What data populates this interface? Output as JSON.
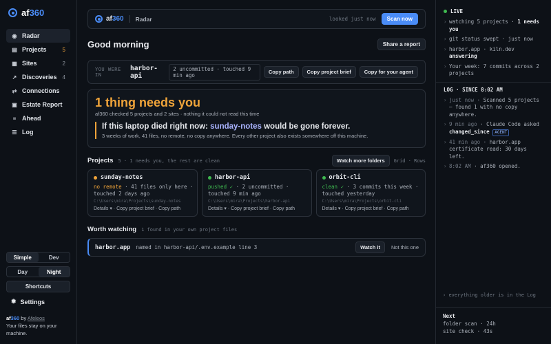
{
  "brand": {
    "name_prefix": "af",
    "name_num": "360"
  },
  "sidebar": {
    "items": [
      {
        "label": "Radar",
        "icon": "radar-icon",
        "count": ""
      },
      {
        "label": "Projects",
        "icon": "bar-chart-icon",
        "count": "5"
      },
      {
        "label": "Sites",
        "icon": "server-icon",
        "count": "2"
      },
      {
        "label": "Discoveries",
        "icon": "trend-icon",
        "count": "4"
      },
      {
        "label": "Connections",
        "icon": "arrows-icon",
        "count": ""
      },
      {
        "label": "Estate Report",
        "icon": "document-icon",
        "count": ""
      },
      {
        "label": "Ahead",
        "icon": "stack-icon",
        "count": ""
      },
      {
        "label": "Log",
        "icon": "list-icon",
        "count": ""
      }
    ],
    "mode": {
      "simple": "Simple",
      "dev": "Dev"
    },
    "theme": {
      "day": "Day",
      "night": "Night"
    },
    "shortcuts": "Shortcuts",
    "settings": "Settings",
    "footer": {
      "by": "by",
      "author": "Afeleos",
      "tagline": "Your files stay on your machine."
    }
  },
  "topbar": {
    "page": "Radar",
    "looked": "looked just now",
    "scan": "Scan now"
  },
  "greeting": "Good morning",
  "share": "Share a report",
  "were_in": {
    "label": "YOU WERE IN",
    "project": "harbor-api",
    "status": "2 uncommitted · touched 9 min ago",
    "actions": [
      "Copy path",
      "Copy project brief",
      "Copy for your agent"
    ]
  },
  "needs": {
    "title": "1 thing needs you",
    "sub": "af360 checked 5 projects and 2 sites · nothing it could not read this time",
    "alert_prefix": "If this laptop died right now: ",
    "alert_project": "sunday-notes",
    "alert_suffix": " would be gone forever.",
    "alert_detail": "3 weeks of work, 41 files, no remote, no copy anywhere. Every other project also exists somewhere off this machine."
  },
  "projects": {
    "title": "Projects",
    "note": "5 · 1 needs you, the rest are clean",
    "watch_more": "Watch more folders",
    "view": "Grid · Rows",
    "cards": [
      {
        "name": "sunday-notes",
        "dot": "#f0a43a",
        "state": "no remote",
        "state_class": "warn",
        "detail": " · 41 files only here ·",
        "touched": "touched 2 days ago",
        "path": "C:\\Users\\mira\\Projects\\sunday-notes",
        "actions": "Details ▾ · Copy project brief · Copy path"
      },
      {
        "name": "harbor-api",
        "dot": "#3fb950",
        "state": "pushed ✓",
        "state_class": "ok",
        "detail": " · 2 uncommitted ·",
        "touched": "touched 9 min ago",
        "path": "C:\\Users\\mira\\Projects\\harbor-api",
        "actions": "Details ▾ · Copy project brief · Copy path"
      },
      {
        "name": "orbit-cli",
        "dot": "#3fb950",
        "state": "clean ✓",
        "state_class": "ok",
        "detail": " · 3 commits this week ·",
        "touched": "touched yesterday",
        "path": "C:\\Users\\mira\\Projects\\orbit-cli",
        "actions": "Details ▾ · Copy project brief · Copy path"
      }
    ]
  },
  "watching": {
    "title": "Worth watching",
    "note": "1 found in your own project files",
    "name": "harbor.app",
    "where": "named in harbor-api/.env.example line 3",
    "watch": "Watch it",
    "not": "Not this one"
  },
  "live": {
    "title": "LIVE",
    "items": [
      {
        "pre": "watching 5 projects · ",
        "bold": "1 needs you",
        "post": ""
      },
      {
        "pre": "git status swept · just now",
        "bold": "",
        "post": ""
      },
      {
        "pre": "harbor.app · kiln.dev ",
        "bold": "answering",
        "post": ""
      },
      {
        "pre": "Your week: 7 commits across 2 projects",
        "bold": "",
        "post": ""
      }
    ]
  },
  "log": {
    "title": "LOG · SINCE 8:02 AM",
    "items": [
      {
        "time": "just now",
        "text": " · Scanned 5 projects — found 1 with no copy anywhere."
      },
      {
        "time": "9 min ago",
        "text": " · Claude Code asked ",
        "bold": "changed_since",
        "badge": "AGENT"
      },
      {
        "time": "41 min ago",
        "text": " · harbor.app certificate read: 30 days left."
      },
      {
        "time": "8:02 AM",
        "text": " · af360 opened."
      }
    ],
    "older": "everything older is in the Log"
  },
  "next": {
    "title": "Next",
    "folder": "folder scan · 24h",
    "site": "site check · 43s"
  }
}
